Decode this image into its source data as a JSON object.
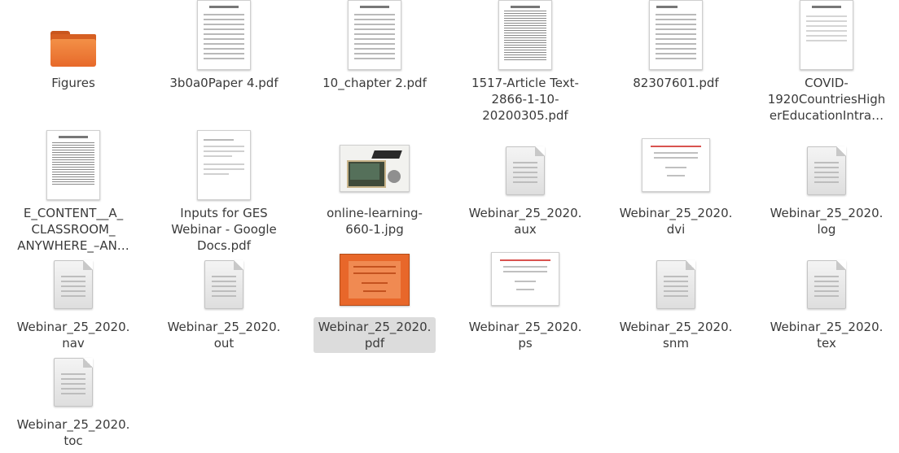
{
  "files": [
    {
      "name": "Figures",
      "icon": "folder-icon"
    },
    {
      "name": "3b0a0Paper 4.pdf",
      "icon": "pdf-thumbnail-icon"
    },
    {
      "name": "10_chapter 2.pdf",
      "icon": "pdf-thumbnail-icon"
    },
    {
      "name": "1517-Article Text-\n2866-1-10-\n20200305.pdf",
      "icon": "pdf-thumbnail-icon"
    },
    {
      "name": "82307601.pdf",
      "icon": "pdf-thumbnail-icon"
    },
    {
      "name": "COVID-\n1920CountriesHigh\nerEducationIntra…",
      "icon": "pdf-thumbnail-icon"
    },
    {
      "name": "E_CONTENT__A_\nCLASSROOM_\nANYWHERE_–AN…",
      "icon": "pdf-thumbnail-icon"
    },
    {
      "name": "Inputs for GES\nWebinar - Google\nDocs.pdf",
      "icon": "pdf-thumbnail-icon"
    },
    {
      "name": "online-learning-\n660-1.jpg",
      "icon": "image-thumbnail-icon"
    },
    {
      "name": "Webinar_25_2020.\naux",
      "icon": "text-file-icon"
    },
    {
      "name": "Webinar_25_2020.\ndvi",
      "icon": "dvi-thumbnail-icon"
    },
    {
      "name": "Webinar_25_2020.\nlog",
      "icon": "text-file-icon"
    },
    {
      "name": "Webinar_25_2020.\nnav",
      "icon": "text-file-icon"
    },
    {
      "name": "Webinar_25_2020.\nout",
      "icon": "text-file-icon"
    },
    {
      "name": "Webinar_25_2020.\npdf",
      "icon": "pdf-thumbnail-icon",
      "selected": true
    },
    {
      "name": "Webinar_25_2020.\nps",
      "icon": "ps-thumbnail-icon"
    },
    {
      "name": "Webinar_25_2020.\nsnm",
      "icon": "text-file-icon"
    },
    {
      "name": "Webinar_25_2020.\ntex",
      "icon": "text-file-icon"
    },
    {
      "name": "Webinar_25_2020.\ntoc",
      "icon": "text-file-icon"
    }
  ],
  "colors": {
    "folder": "#e8692a",
    "selection": "#dcdcdc",
    "selected_thumbnail": "#e8672a",
    "text": "#3a3a3a"
  }
}
